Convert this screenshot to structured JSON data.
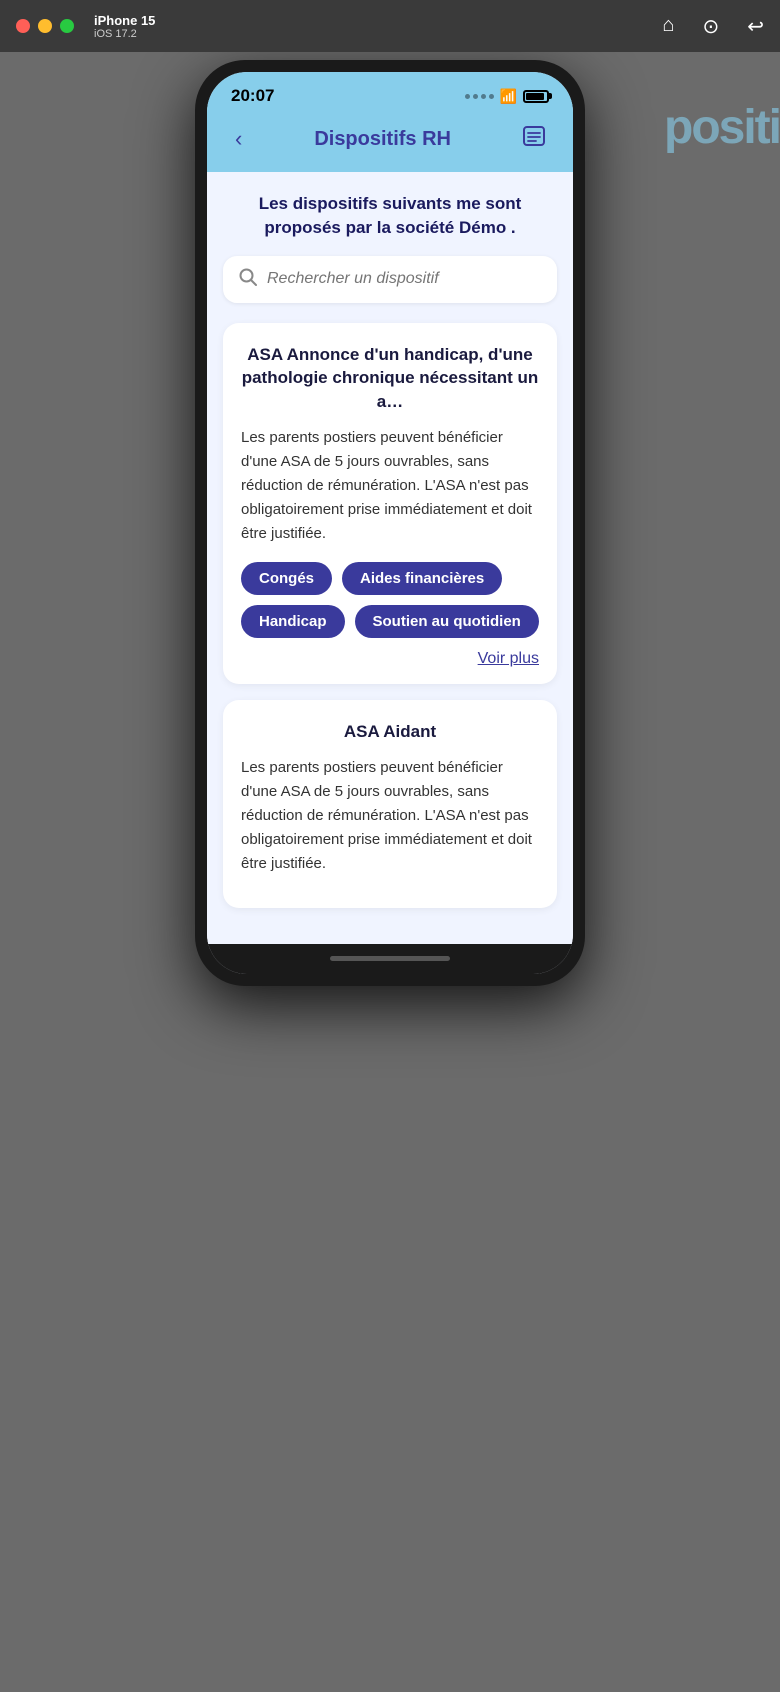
{
  "desktop": {
    "model": "iPhone 15",
    "os": "iOS 17.2",
    "icons": [
      "🏠",
      "📷",
      "↩"
    ]
  },
  "status_bar": {
    "time": "20:07"
  },
  "header": {
    "back_label": "‹",
    "title": "Dispositifs RH",
    "menu_icon": "≡"
  },
  "page": {
    "subtitle": "Les dispositifs suivants me sont proposés par la société Démo ."
  },
  "search": {
    "placeholder": "Rechercher un dispositif"
  },
  "cards": [
    {
      "title": "ASA Annonce d'un handicap, d'une pathologie chronique nécessitant un a…",
      "body": "Les parents postiers peuvent bénéficier d'une ASA de 5 jours ouvrables, sans réduction de rémunération. L'ASA n'est pas obligatoirement prise immédiatement et doit être justifiée.",
      "tags": [
        "Congés",
        "Aides financières",
        "Handicap",
        "Soutien au quotidien"
      ],
      "voir_plus": "Voir plus"
    },
    {
      "title": "ASA Aidant",
      "body": "Les parents postiers peuvent bénéficier d'une ASA de 5 jours ouvrables, sans réduction de rémunération. L'ASA n'est pas obligatoirement prise immédiatement et doit être justifiée.",
      "tags": [],
      "voir_plus": ""
    }
  ],
  "bg_hint": "positi"
}
